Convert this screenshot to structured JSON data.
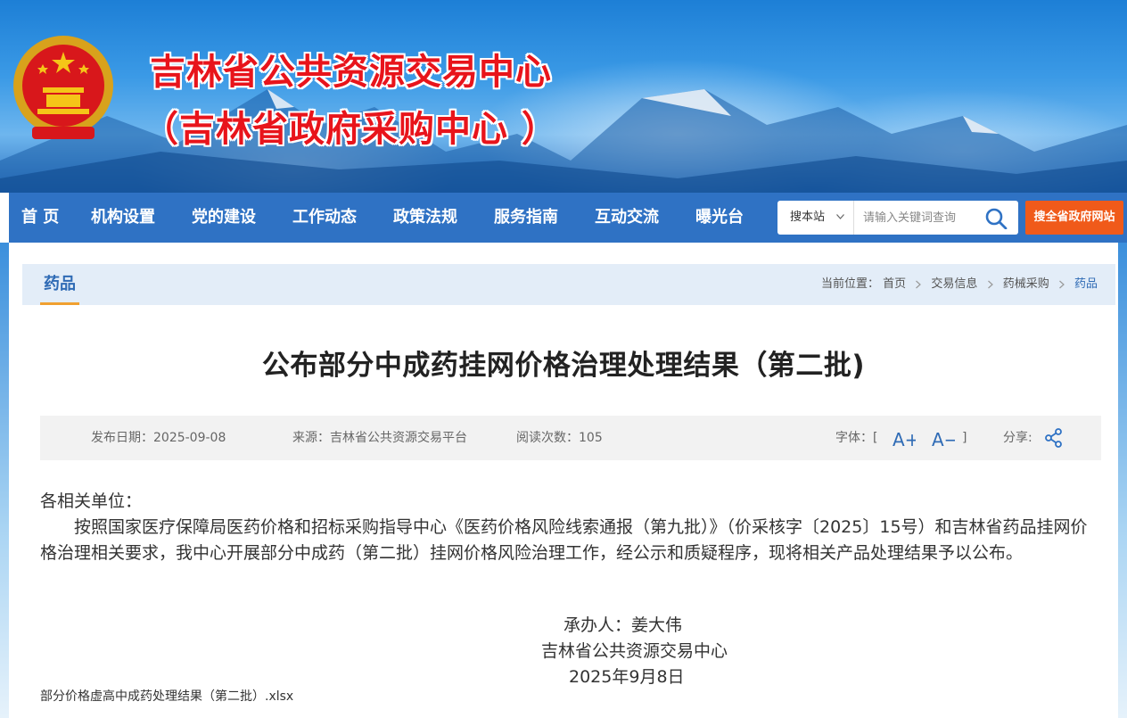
{
  "header": {
    "title_line1": "吉林省公共资源交易中心",
    "title_line2": "（吉林省政府采购中心 ）",
    "emblem": "national-emblem"
  },
  "nav": {
    "items": [
      "首 页",
      "机构设置",
      "党的建设",
      "工作动态",
      "政策法规",
      "服务指南",
      "互动交流",
      "曝光台"
    ],
    "search_scope": "搜本站",
    "search_placeholder": "请输入关键词查询",
    "search_all_label": "搜全省政府网站"
  },
  "column": {
    "title": "药品",
    "breadcrumb_prefix": "当前位置：",
    "breadcrumb": [
      "首页",
      "交易信息",
      "药械采购",
      "药品"
    ]
  },
  "article": {
    "title": "公布部分中成药挂网价格治理处理结果（第二批)",
    "publish_date": "发布日期：2025-09-08",
    "source": "来源：吉林省公共资源交易平台",
    "reads": "阅读次数：105",
    "font_label": "字体：[",
    "font_bracket_close": "]",
    "font_increase": "A+",
    "font_decrease": "A−",
    "share_label": "分享:",
    "salutation": "各相关单位：",
    "body": "按照国家医疗保障局医药价格和招标采购指导中心《医药价格风险线索通报（第九批）》（价采核字〔2025〕15号）和吉林省药品挂网价格治理相关要求，我中心开展部分中成药（第二批）挂网价格风险治理工作，经公示和质疑程序，现将相关产品处理结果予以公布。",
    "contact": "承办人：姜大伟",
    "issuer": "吉林省公共资源交易中心",
    "date": "2025年9月8日",
    "attachment": "部分价格虚高中成药处理结果（第二批）.xlsx"
  },
  "colors": {
    "nav_bg": "#2f72c4",
    "title_red": "#e8141b",
    "search_all_bg": "#f05a1a",
    "column_bar_bg": "#e3edf8",
    "column_accent": "#f0a030",
    "link_blue": "#2f6bb5"
  }
}
